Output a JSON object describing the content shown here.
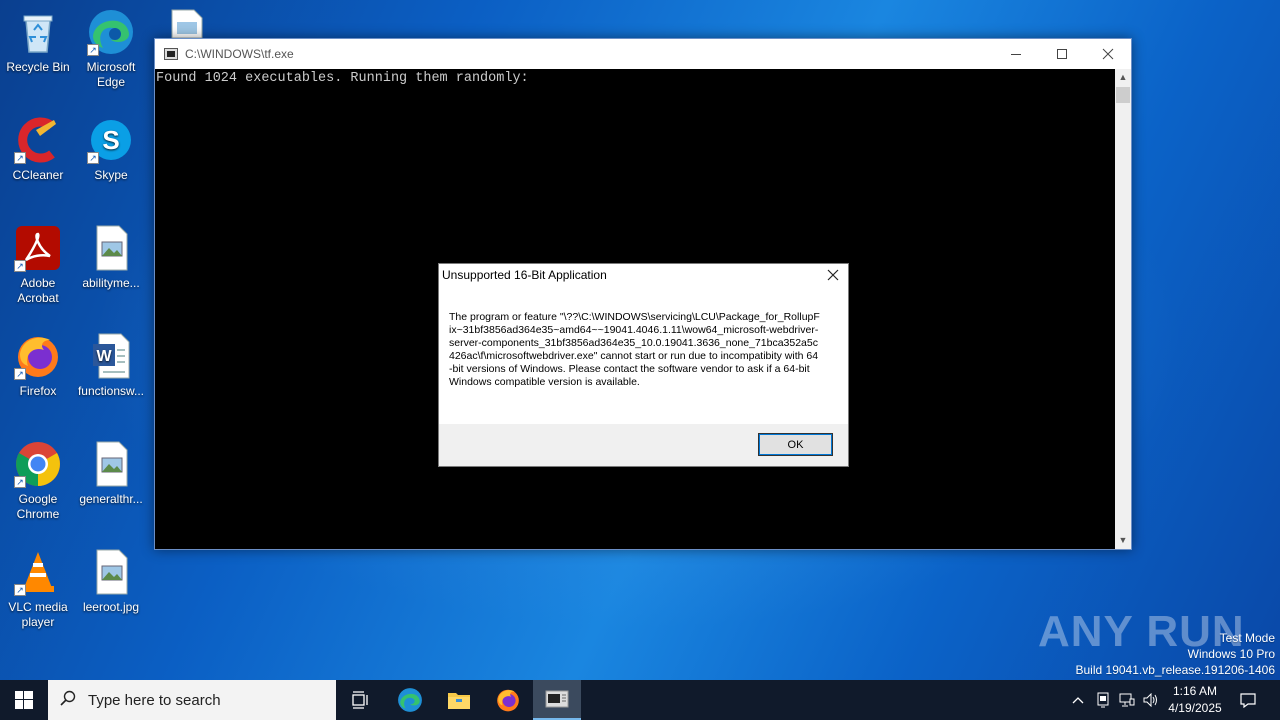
{
  "desktop": {
    "icons": [
      {
        "label": "Recycle Bin",
        "icon": "recycle-bin-icon"
      },
      {
        "label": "Microsoft Edge",
        "icon": "edge-icon"
      },
      {
        "label": "CCleaner",
        "icon": "ccleaner-icon"
      },
      {
        "label": "Skype",
        "icon": "skype-icon"
      },
      {
        "label": "Adobe Acrobat",
        "icon": "acrobat-icon"
      },
      {
        "label": "abilityme...",
        "icon": "image-file-icon"
      },
      {
        "label": "Firefox",
        "icon": "firefox-icon"
      },
      {
        "label": "functionsw...",
        "icon": "word-doc-icon"
      },
      {
        "label": "Google Chrome",
        "icon": "chrome-icon"
      },
      {
        "label": "generalthr...",
        "icon": "image-file-icon"
      },
      {
        "label": "VLC media player",
        "icon": "vlc-icon"
      },
      {
        "label": "leeroot.jpg",
        "icon": "image-file-icon"
      }
    ]
  },
  "console": {
    "title": "C:\\WINDOWS\\tf.exe",
    "output": "Found 1024 executables. Running them randomly:"
  },
  "dialog": {
    "title": "Unsupported 16-Bit Application",
    "message": "The program or feature \"\\??\\C:\\WINDOWS\\servicing\\LCU\\Package_for_RollupFix~31bf3856ad364e35~amd64~~19041.4046.1.11\\wow64_microsoft-webdriver-server-components_31bf3856ad364e35_10.0.19041.3636_none_71bca352a5c426ac\\f\\microsoftwebdriver.exe\" cannot start or run due to incompatibity with 64-bit versions of Windows. Please contact the software vendor to ask if a 64-bit Windows compatible version is available.",
    "ok_label": "OK"
  },
  "watermark": {
    "logo": "ANY RUN",
    "line1": "Test Mode",
    "line2": "Windows 10 Pro",
    "line3": "Build 19041.vb_release.191206-1406"
  },
  "taskbar": {
    "search_placeholder": "Type here to search",
    "time": "1:16 AM",
    "date": "4/19/2025"
  },
  "colors": {
    "taskbar": "#101a2b",
    "accent": "#0078d7"
  }
}
